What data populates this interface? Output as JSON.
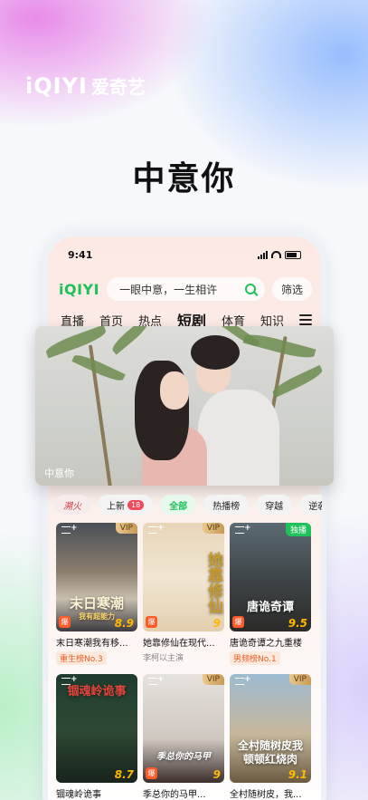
{
  "brand": {
    "logo": "iQIYI",
    "name_cn": "爱奇艺"
  },
  "headline": "中意你",
  "status": {
    "time": "9:41"
  },
  "search": {
    "app_logo": "iQIYI",
    "placeholder": "一眼中意，一生相许",
    "filter_label": "筛选"
  },
  "tabs": [
    "直播",
    "首页",
    "热点",
    "短剧",
    "体育",
    "知识"
  ],
  "active_tab": "短剧",
  "banner": {
    "caption": "中意你"
  },
  "tags": {
    "logo": "溯火",
    "new_label": "上新",
    "new_count": "18",
    "all": "全部",
    "hot_list": "热播榜",
    "time_travel": "穿越",
    "counterattack": "逆袭"
  },
  "cards": [
    {
      "poster_title": "末日寒潮",
      "poster_sub": "我有超能力",
      "badge": "VIP",
      "score": "8.9",
      "hot": "爆",
      "title": "末日寒潮我有移...",
      "sub": "重生榜No.3",
      "sub_style": "rank"
    },
    {
      "poster_title": "她靠修仙",
      "badge": "VIP",
      "score": "9",
      "hot": "爆",
      "title": "她靠修仙在现代...",
      "sub": "李柯以主演",
      "sub_style": "plain"
    },
    {
      "poster_title": "唐诡奇谭",
      "badge": "独播",
      "score": "9.5",
      "hot": "爆",
      "title": "唐诡奇谭之九重楼",
      "sub": "男频榜No.1",
      "sub_style": "rank"
    },
    {
      "poster_title": "锢魂岭诡事",
      "badge": "",
      "score": "8.7",
      "hot": "",
      "title": "锢魂岭诡事",
      "sub": "",
      "sub_style": "plain"
    },
    {
      "poster_title": "季总你的马甲",
      "badge": "VIP",
      "score": "9",
      "hot": "爆",
      "title": "季总你的马甲...",
      "sub": "",
      "sub_style": "plain"
    },
    {
      "poster_title": "全村随树皮我顿顿红烧肉",
      "badge": "VIP",
      "score": "9.1",
      "hot": "",
      "title": "全村随树皮，我...",
      "sub": "",
      "sub_style": "plain"
    }
  ],
  "colors": {
    "accent": "#1ec15a",
    "hot": "#ff5a2a",
    "score": "#ffb700"
  }
}
